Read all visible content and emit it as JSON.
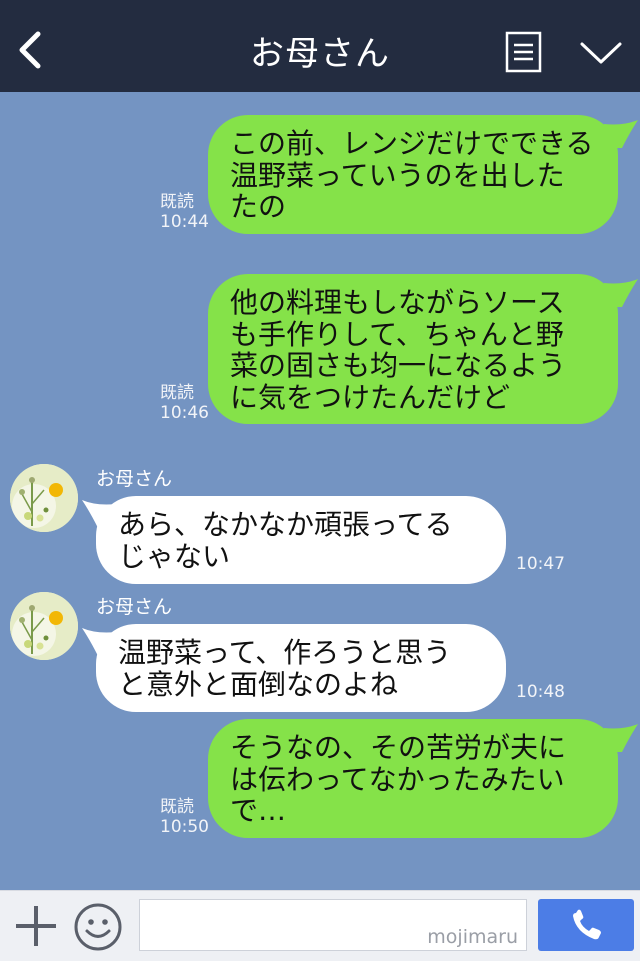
{
  "header": {
    "title": "お母さん",
    "back_icon": "chevron-left-icon",
    "menu_icon": "menu-list-icon",
    "collapse_icon": "chevron-down-icon"
  },
  "messages": [
    {
      "lines": [
        "この前、レンジだけでできる",
        "温野菜っていうのを出した",
        "たの"
      ],
      "read": "既読",
      "time": "10:44"
    },
    {
      "lines": [
        "他の料理もしながらソース",
        "も手作りして、ちゃんと野",
        "菜の固さも均一になるよう",
        "に気をつけたんだけど"
      ],
      "read": "既読",
      "time": "10:46"
    },
    {
      "sender": "お母さん",
      "lines": [
        "あら、なかなか頑張ってる",
        "じゃない"
      ],
      "time": "10:47"
    },
    {
      "sender": "お母さん",
      "lines": [
        "温野菜って、作ろうと思う",
        "と意外と面倒なのよね"
      ],
      "time": "10:48"
    },
    {
      "lines": [
        "そうなの、その苦労が夫に",
        "は伝わってなかったみたい",
        "で…"
      ],
      "read": "既読",
      "time": "10:50"
    }
  ],
  "input_bar": {
    "placeholder": "",
    "watermark": "mojimaru",
    "plus_icon": "plus-icon",
    "emoji_icon": "smiley-icon",
    "call_icon": "phone-icon"
  },
  "colors": {
    "header_bg": "#232c40",
    "chat_bg": "#7494c2",
    "sent_bubble": "#85e249",
    "received_bubble": "#ffffff",
    "call_button": "#4c7de6"
  }
}
